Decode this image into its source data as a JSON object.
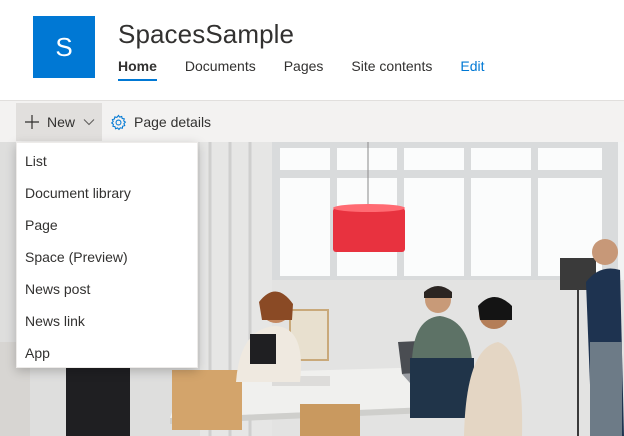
{
  "site": {
    "logo_letter": "S",
    "title": "SpacesSample"
  },
  "nav": [
    {
      "label": "Home",
      "active": true
    },
    {
      "label": "Documents"
    },
    {
      "label": "Pages"
    },
    {
      "label": "Site contents"
    },
    {
      "label": "Edit",
      "link": true
    }
  ],
  "command_bar": {
    "new_label": "New",
    "page_details_label": "Page details"
  },
  "new_menu": {
    "items": [
      "List",
      "Document library",
      "Page",
      "Space (Preview)",
      "News post",
      "News link",
      "App"
    ]
  },
  "colors": {
    "brand": "#0078d4",
    "command_bar_bg": "#f3f2f1",
    "pendant_lamp": "#e83a46"
  },
  "hero": {
    "description_icon": "office-meeting-photo"
  }
}
